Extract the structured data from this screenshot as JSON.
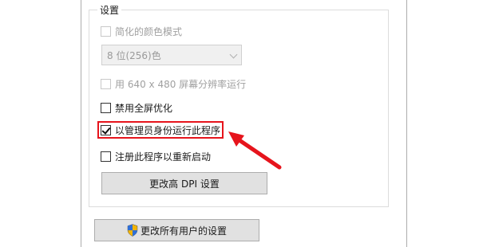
{
  "group": {
    "title": "设置"
  },
  "options": {
    "reduced_color": {
      "label": "简化的颜色模式",
      "checked": false,
      "disabled": true
    },
    "color_select": {
      "value": "8 位(256)色",
      "disabled": true
    },
    "res_640": {
      "label": "用 640 x 480 屏幕分辨率运行",
      "checked": false,
      "disabled": true
    },
    "disable_fullscreen": {
      "label": "禁用全屏优化",
      "checked": false
    },
    "run_as_admin": {
      "label": "以管理员身份运行此程序",
      "checked": true
    },
    "register_restart": {
      "label": "注册此程序以重新启动",
      "checked": false
    }
  },
  "buttons": {
    "change_dpi": "更改高 DPI 设置",
    "change_all_users": "更改所有用户的设置"
  },
  "annotation": {
    "color": "#e6141c"
  },
  "icons": {
    "shield": "uac-shield-icon"
  }
}
